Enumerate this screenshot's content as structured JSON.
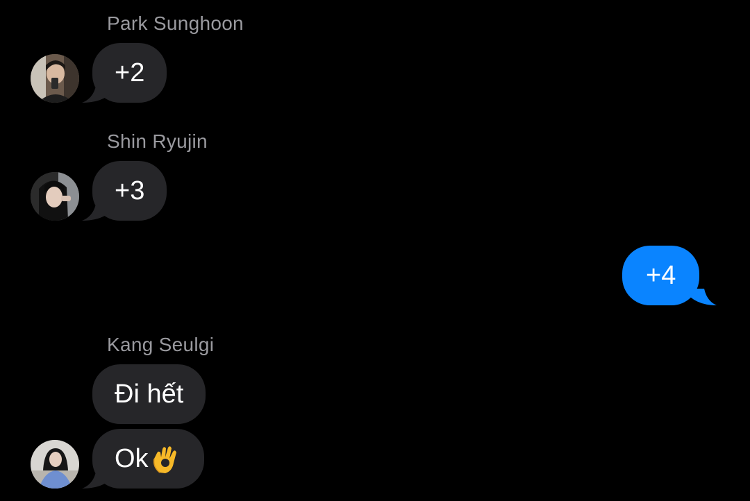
{
  "messages": [
    {
      "sender": "Park Sunghoon",
      "text": "+2",
      "avatar_icon": "avatar-photo-park-sunghoon"
    },
    {
      "sender": "Shin Ryujin",
      "text": "+3",
      "avatar_icon": "avatar-photo-shin-ryujin"
    },
    {
      "outgoing": true,
      "text": "+4"
    },
    {
      "sender": "Kang Seulgi",
      "text": "Đi hết"
    },
    {
      "text": "Ok",
      "emoji": "ok-hand-emoji",
      "avatar_icon": "avatar-photo-kang-seulgi"
    }
  ],
  "colors": {
    "background": "#000000",
    "incoming_bubble": "#262629",
    "outgoing_bubble": "#0a84ff",
    "sender_name": "#9a9a9f",
    "text": "#ffffff"
  }
}
